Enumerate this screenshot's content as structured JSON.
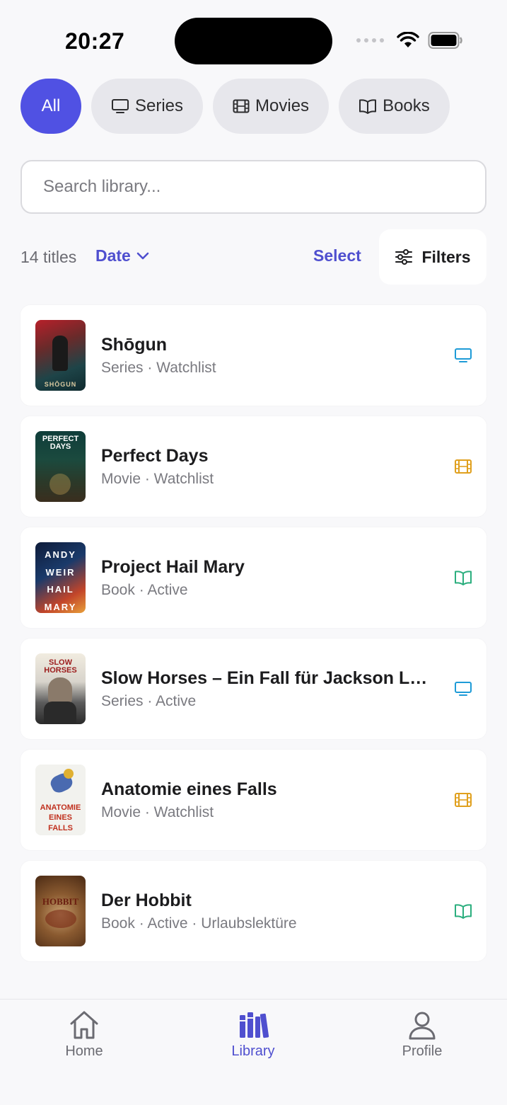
{
  "status_bar": {
    "time": "20:27"
  },
  "segments": [
    {
      "label": "All",
      "icon": "none",
      "active": true
    },
    {
      "label": "Series",
      "icon": "tv-icon",
      "active": false
    },
    {
      "label": "Movies",
      "icon": "film-icon",
      "active": false
    },
    {
      "label": "Books",
      "icon": "book-icon",
      "active": false
    }
  ],
  "search": {
    "placeholder": "Search library...",
    "value": ""
  },
  "controls": {
    "count": "14 titles",
    "sort_label": "Date",
    "select_label": "Select",
    "filters_label": "Filters"
  },
  "items": [
    {
      "title": "Shōgun",
      "meta": "Series · Watchlist",
      "type_icon": "tv-icon",
      "type_color": "#1e9bd7",
      "poster_text": "SHŌGUN"
    },
    {
      "title": "Perfect Days",
      "meta": "Movie · Watchlist",
      "type_icon": "film-icon",
      "type_color": "#e0a01e",
      "poster_text": "PERFECT DAYS"
    },
    {
      "title": "Project Hail Mary",
      "meta": "Book · Active",
      "type_icon": "book-icon",
      "type_color": "#2bae7e",
      "poster_text": "ANDY WEIR HAIL MARY"
    },
    {
      "title": "Slow Horses – Ein Fall für Jackson La...",
      "meta": "Series · Active",
      "type_icon": "tv-icon",
      "type_color": "#1e9bd7",
      "poster_text": "SLOW HORSES"
    },
    {
      "title": "Anatomie eines Falls",
      "meta": "Movie · Watchlist",
      "type_icon": "film-icon",
      "type_color": "#e0a01e",
      "poster_text": "ANATOMIE EINES FALLS"
    },
    {
      "title": "Der Hobbit",
      "meta": "Book · Active · Urlaubslektüre",
      "type_icon": "book-icon",
      "type_color": "#2bae7e",
      "poster_text": "HOBBIT"
    }
  ],
  "nav": {
    "home": "Home",
    "library": "Library",
    "profile": "Profile"
  },
  "colors": {
    "accent": "#5051e3",
    "accent_text": "#4f4fcf"
  }
}
